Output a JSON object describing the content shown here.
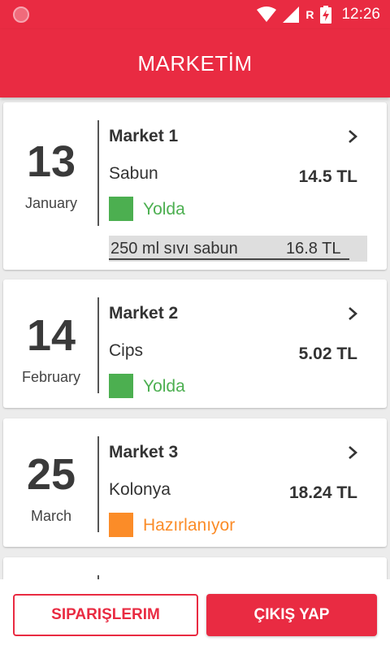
{
  "status_bar": {
    "time": "12:26",
    "roaming_label": "R",
    "icons": [
      "notification-icon",
      "wifi-icon",
      "signal-icon",
      "battery-charging-icon"
    ]
  },
  "app_bar": {
    "title": "MARKETİM"
  },
  "orders": [
    {
      "day": "13",
      "month": "January",
      "market": "Market 1",
      "product": "Sabun",
      "price": "14.5 TL",
      "status": "Yolda",
      "status_color": "#4caf50",
      "note": {
        "text": "250 ml sıvı sabun",
        "price": "16.8 TL"
      }
    },
    {
      "day": "14",
      "month": "February",
      "market": "Market 2",
      "product": "Cips",
      "price": "5.02 TL",
      "status": "Yolda",
      "status_color": "#4caf50"
    },
    {
      "day": "25",
      "month": "March",
      "market": "Market 3",
      "product": "Kolonya",
      "price": "18.24 TL",
      "status": "Hazırlanıyor",
      "status_color": "#fb8c28"
    }
  ],
  "buttons": {
    "orders": "SIPARIŞLERIM",
    "logout": "ÇIKIŞ YAP"
  },
  "colors": {
    "primary": "#e92b42",
    "in_transit": "#4caf50",
    "preparing": "#fb8c28"
  }
}
